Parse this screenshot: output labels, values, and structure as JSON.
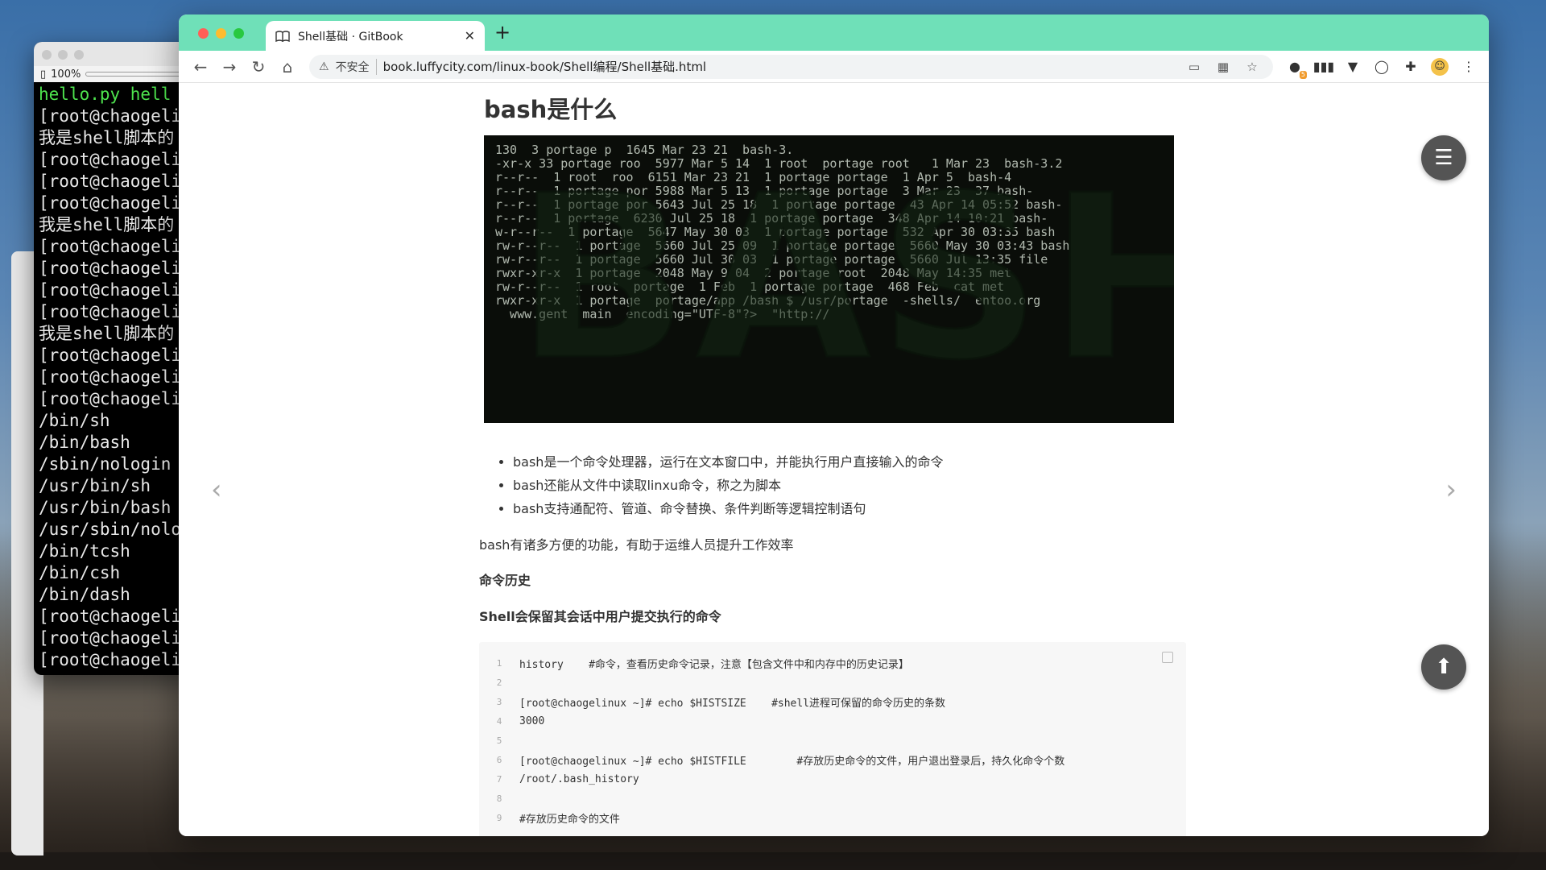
{
  "terminal": {
    "zoom": "100%",
    "lines": [
      {
        "text": "hello.py  hell",
        "color": "green"
      },
      {
        "text": "[root@chaogeli",
        "color": "normal"
      },
      {
        "text": "我是shell脚本的",
        "color": "normal"
      },
      {
        "text": "[root@chaogeli",
        "color": "normal"
      },
      {
        "text": "[root@chaogeli",
        "color": "normal"
      },
      {
        "text": "[root@chaogeli",
        "color": "normal"
      },
      {
        "text": "我是shell脚本的",
        "color": "normal"
      },
      {
        "text": "[root@chaogeli",
        "color": "normal"
      },
      {
        "text": "[root@chaogeli",
        "color": "normal"
      },
      {
        "text": "[root@chaogeli",
        "color": "normal"
      },
      {
        "text": "[root@chaogeli",
        "color": "normal"
      },
      {
        "text": "我是shell脚本的",
        "color": "normal"
      },
      {
        "text": "[root@chaogeli",
        "color": "normal"
      },
      {
        "text": "[root@chaogeli",
        "color": "normal"
      },
      {
        "text": "[root@chaogeli",
        "color": "normal"
      },
      {
        "text": "/bin/sh",
        "color": "normal"
      },
      {
        "text": "/bin/bash",
        "color": "normal"
      },
      {
        "text": "/sbin/nologin",
        "color": "normal"
      },
      {
        "text": "/usr/bin/sh",
        "color": "normal"
      },
      {
        "text": "/usr/bin/bash",
        "color": "normal"
      },
      {
        "text": "/usr/sbin/nolo",
        "color": "normal"
      },
      {
        "text": "/bin/tcsh",
        "color": "normal"
      },
      {
        "text": "/bin/csh",
        "color": "normal"
      },
      {
        "text": "/bin/dash",
        "color": "normal"
      },
      {
        "text": "[root@chaogeli",
        "color": "normal"
      },
      {
        "text": "[root@chaogeli",
        "color": "normal"
      },
      {
        "text": "[root@chaogeli",
        "color": "normal"
      }
    ]
  },
  "browser": {
    "tab_title": "Shell基础 · GitBook",
    "tab_close": "✕",
    "new_tab": "+",
    "insecure_label": "不安全",
    "url": "book.luffycity.com/linux-book/Shell编程/Shell基础.html",
    "tabstrip_color": "#6fe0b8",
    "ext_badge": "5"
  },
  "page": {
    "heading": "bash是什么",
    "hero_word": "BASH",
    "hero_background_text": "130  3 portage p  1645 Mar 23 21  bash-3.\n-xr-x 33 portage roo  5977 Mar 5 14  1 root  portage root   1 Mar 23  bash-3.2\nr--r--  1 root  roo  6151 Mar 23 21  1 portage portage  1 Apr 5  bash-4\nr--r--  1 portage por 5988 Mar 5 13  1 portage portage  3 Mar 23  37 bash-\nr--r--  1 portage por 5643 Jul 25 18  1 portage portage  43 Apr 14 05:52 bash-\nr--r--  1 portage  6230 Jul 25 18  1 portage portage  348 Apr 14 10:21 bash-\nw-r--r--  1 portage  5647 May 30 03  1 portage portage  532 Apr 30 03:35 bash\nrw-r--r--  1 portage  5660 Jul 25 09  1 portage portage  5660 May 30 03:43 bash\nrw-r--r--  1 portage  5660 Jul 30 03  1 portage portage  5660 Jul 13:35 file\nrwxr-xr-x  1 portage  2048 May 9 04  2 portage root  2048 May 14:35 met\nrw-r--r--  1 root  portage  1 Feb  1 portage portage  468 Feb  cat met\nrwxr-xr-x  1 portage  portage/app /bash $ /usr/portage  -shells/  entoo.org\n  www.gent  main  encoding=\"UTF-8\"?>  \"http://",
    "bullets": [
      "bash是一个命令处理器，运行在文本窗口中，并能执行用户直接输入的命令",
      "bash还能从文件中读取linxu命令，称之为脚本",
      "bash支持通配符、管道、命令替换、条件判断等逻辑控制语句"
    ],
    "paragraph": "bash有诸多方便的功能，有助于运维人员提升工作效率",
    "subheading": "命令历史",
    "subheading2": "Shell会保留其会话中用户提交执行的命令",
    "code_lines": [
      {
        "n": "1",
        "text": "history    #命令，查看历史命令记录，注意【包含文件中和内存中的历史记录】"
      },
      {
        "n": "2",
        "text": ""
      },
      {
        "n": "3",
        "text": "[root@chaogelinux ~]# echo $HISTSIZE    #shell进程可保留的命令历史的条数"
      },
      {
        "n": "4",
        "text": "3000"
      },
      {
        "n": "5",
        "text": ""
      },
      {
        "n": "6",
        "text": "[root@chaogelinux ~]# echo $HISTFILE        #存放历史命令的文件，用户退出登录后，持久化命令个数"
      },
      {
        "n": "7",
        "text": "/root/.bash_history"
      },
      {
        "n": "8",
        "text": ""
      },
      {
        "n": "9",
        "text": "#存放历史命令的文件"
      }
    ]
  }
}
